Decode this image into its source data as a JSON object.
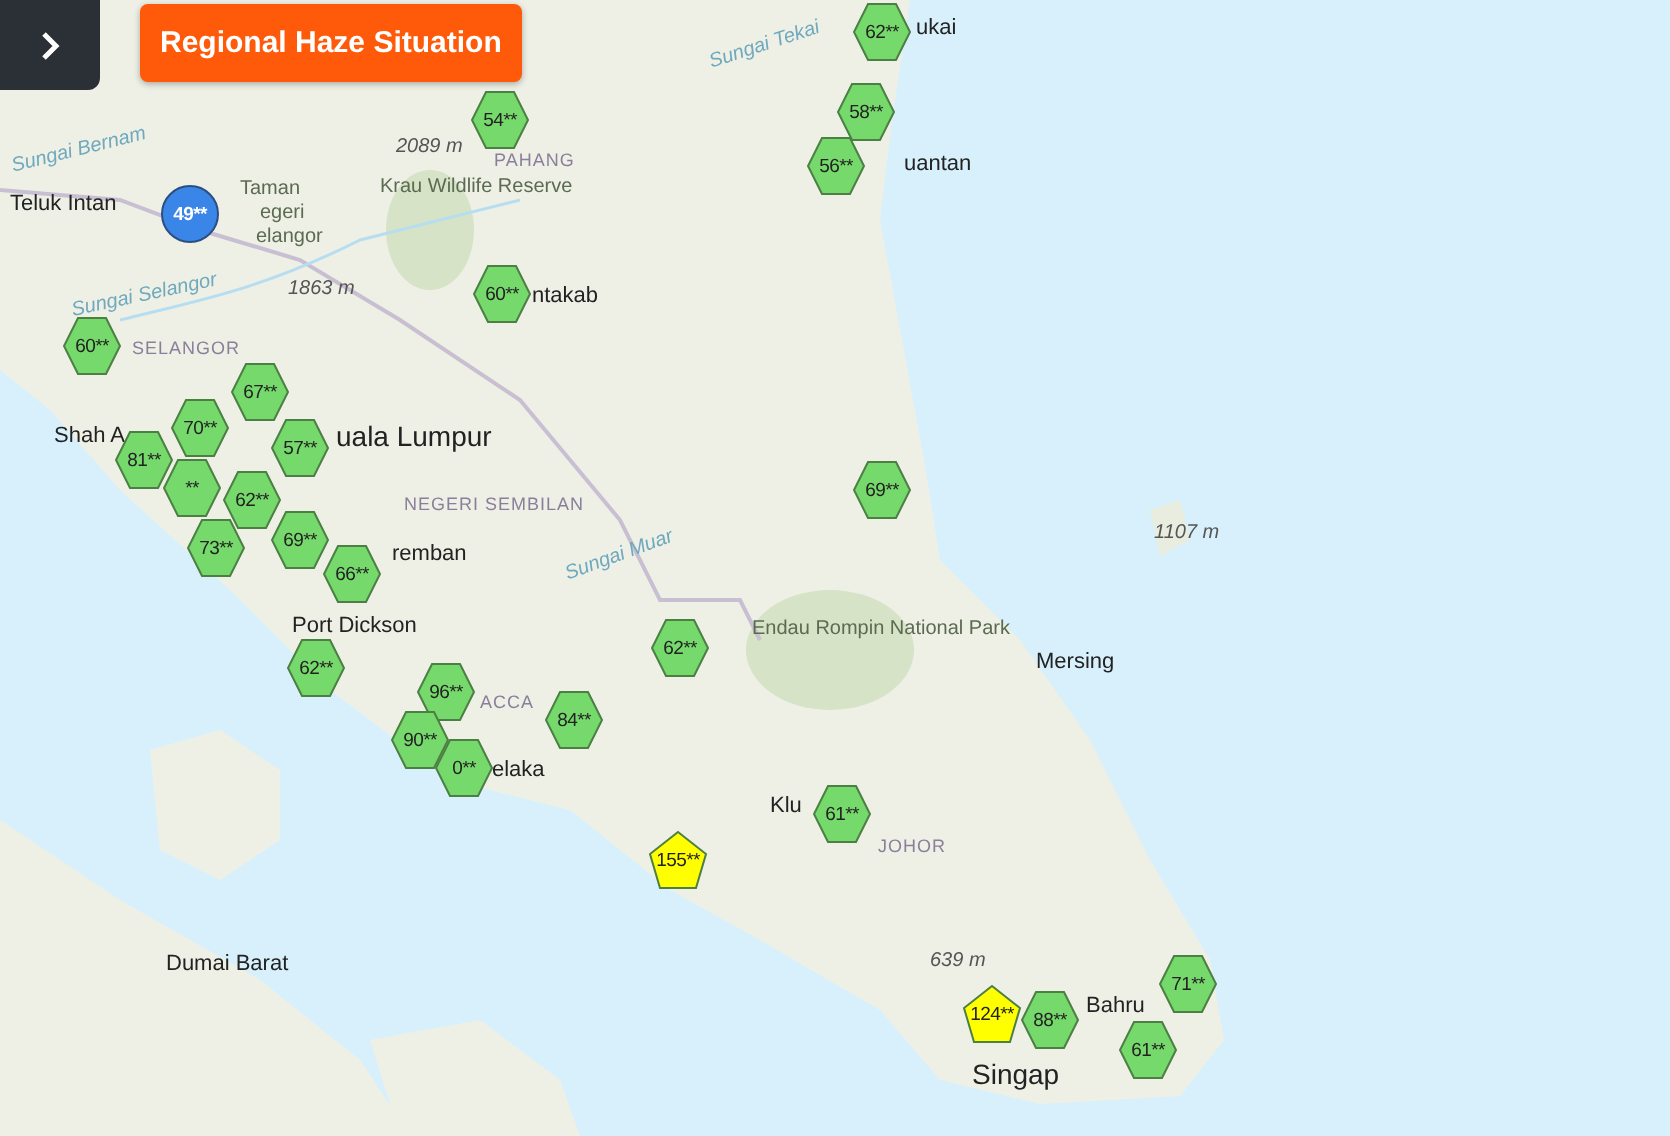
{
  "title_button": {
    "label": "Regional Haze Situation"
  },
  "map_labels": [
    {
      "kind": "place",
      "text": "Teluk Intan"
    },
    {
      "kind": "river",
      "text": "Sungai Bernam"
    },
    {
      "kind": "park",
      "text": "Taman"
    },
    {
      "kind": "park",
      "text": "egeri"
    },
    {
      "kind": "park",
      "text": "elangor"
    },
    {
      "kind": "elevation",
      "text": "2089 m"
    },
    {
      "kind": "region",
      "text": "PAHANG"
    },
    {
      "kind": "park",
      "text": "Krau Wildlife Reserve"
    },
    {
      "kind": "river",
      "text": "Sungai Selangor"
    },
    {
      "kind": "elevation",
      "text": "1863 m"
    },
    {
      "kind": "place",
      "text": "ntakab"
    },
    {
      "kind": "region",
      "text": "SELANGOR"
    },
    {
      "kind": "place",
      "text": "Shah A"
    },
    {
      "kind": "city",
      "text": "uala Lumpur"
    },
    {
      "kind": "region",
      "text": "NEGERI SEMBILAN"
    },
    {
      "kind": "place",
      "text": "remban"
    },
    {
      "kind": "river",
      "text": "Sungai Muar"
    },
    {
      "kind": "place",
      "text": "Port Dickson"
    },
    {
      "kind": "region",
      "text": "ACCA"
    },
    {
      "kind": "place",
      "text": "elaka"
    },
    {
      "kind": "place",
      "text": "Dumai Barat"
    },
    {
      "kind": "park",
      "text": "Endau Rompin National Park"
    },
    {
      "kind": "place",
      "text": "Mersing"
    },
    {
      "kind": "elevation",
      "text": "1107 m"
    },
    {
      "kind": "place",
      "text": "Klu"
    },
    {
      "kind": "region",
      "text": "JOHOR"
    },
    {
      "kind": "elevation",
      "text": "639 m"
    },
    {
      "kind": "place",
      "text": "Bahru"
    },
    {
      "kind": "city",
      "text": "Singap"
    },
    {
      "kind": "river",
      "text": "Sungai Tekai"
    },
    {
      "kind": "place",
      "text": "ukai"
    },
    {
      "kind": "place",
      "text": "uantan"
    }
  ],
  "markers": [
    {
      "kind": "hexagon",
      "color": "#76d96b",
      "text": "62**"
    },
    {
      "kind": "hexagon",
      "color": "#76d96b",
      "text": "54**"
    },
    {
      "kind": "hexagon",
      "color": "#76d96b",
      "text": "58**"
    },
    {
      "kind": "hexagon",
      "color": "#76d96b",
      "text": "56**"
    },
    {
      "kind": "circle",
      "color": "#3a86e8",
      "text": "49**"
    },
    {
      "kind": "hexagon",
      "color": "#76d96b",
      "text": "60**"
    },
    {
      "kind": "hexagon",
      "color": "#76d96b",
      "text": "60**"
    },
    {
      "kind": "hexagon",
      "color": "#76d96b",
      "text": "67**"
    },
    {
      "kind": "hexagon",
      "color": "#76d96b",
      "text": "57**"
    },
    {
      "kind": "hexagon",
      "color": "#76d96b",
      "text": "70**"
    },
    {
      "kind": "hexagon",
      "color": "#76d96b",
      "text": "81**"
    },
    {
      "kind": "hexagon",
      "color": "#76d96b",
      "text": "**"
    },
    {
      "kind": "hexagon",
      "color": "#76d96b",
      "text": "62**"
    },
    {
      "kind": "hexagon",
      "color": "#76d96b",
      "text": "73**"
    },
    {
      "kind": "hexagon",
      "color": "#76d96b",
      "text": "69**"
    },
    {
      "kind": "hexagon",
      "color": "#76d96b",
      "text": "66**"
    },
    {
      "kind": "hexagon",
      "color": "#76d96b",
      "text": "69**"
    },
    {
      "kind": "hexagon",
      "color": "#76d96b",
      "text": "62**"
    },
    {
      "kind": "hexagon",
      "color": "#76d96b",
      "text": "62**"
    },
    {
      "kind": "hexagon",
      "color": "#76d96b",
      "text": "96**"
    },
    {
      "kind": "hexagon",
      "color": "#76d96b",
      "text": "90**"
    },
    {
      "kind": "hexagon",
      "color": "#76d96b",
      "text": "0**"
    },
    {
      "kind": "hexagon",
      "color": "#76d96b",
      "text": "84**"
    },
    {
      "kind": "pentagon",
      "color": "#ffff00",
      "text": "155**"
    },
    {
      "kind": "hexagon",
      "color": "#76d96b",
      "text": "61**"
    },
    {
      "kind": "pentagon",
      "color": "#ffff00",
      "text": "124**"
    },
    {
      "kind": "hexagon",
      "color": "#76d96b",
      "text": "88**"
    },
    {
      "kind": "hexagon",
      "color": "#76d96b",
      "text": "71**"
    },
    {
      "kind": "hexagon",
      "color": "#76d96b",
      "text": "61**"
    }
  ]
}
